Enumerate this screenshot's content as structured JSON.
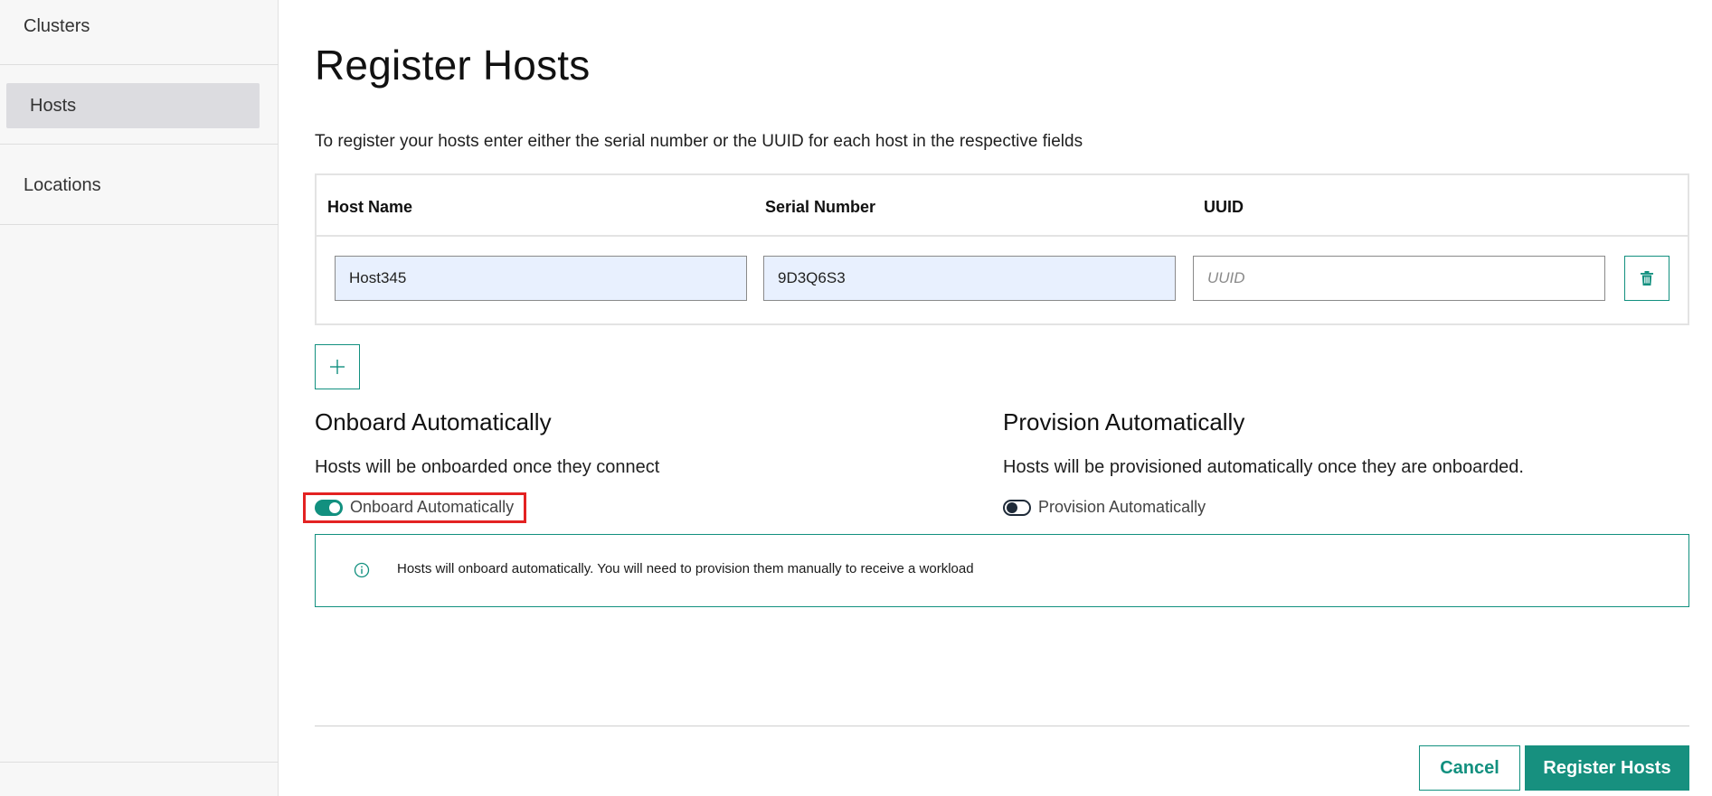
{
  "sidebar": {
    "items": [
      {
        "label": "Clusters",
        "active": false
      },
      {
        "label": "Hosts",
        "active": true
      },
      {
        "label": "Locations",
        "active": false
      }
    ]
  },
  "page": {
    "title": "Register Hosts",
    "intro": "To register your hosts enter either the serial number or the UUID for each host in the respective fields"
  },
  "table": {
    "columns": [
      "Host Name",
      "Serial Number",
      "UUID"
    ],
    "rows": [
      {
        "host_name": "Host345",
        "serial_number": "9D3Q6S3",
        "uuid": "",
        "uuid_placeholder": "UUID"
      }
    ]
  },
  "onboard": {
    "title": "Onboard Automatically",
    "description": "Hosts will be onboarded once they connect",
    "toggle_label": "Onboard Automatically",
    "enabled": true
  },
  "provision": {
    "title": "Provision Automatically",
    "description": "Hosts will be provisioned automatically once they are onboarded.",
    "toggle_label": "Provision Automatically",
    "enabled": false
  },
  "info_banner": {
    "message": "Hosts will onboard automatically. You will need to provision them manually to receive a workload"
  },
  "footer": {
    "cancel_label": "Cancel",
    "submit_label": "Register Hosts"
  },
  "colors": {
    "accent": "#12907f",
    "highlight": "#e32222",
    "filled_input": "#e8f0fe",
    "sidebar_active": "#dcdce0"
  },
  "icons": {
    "delete_row": "trash-icon",
    "add_row": "plus-icon",
    "info": "info-icon"
  }
}
